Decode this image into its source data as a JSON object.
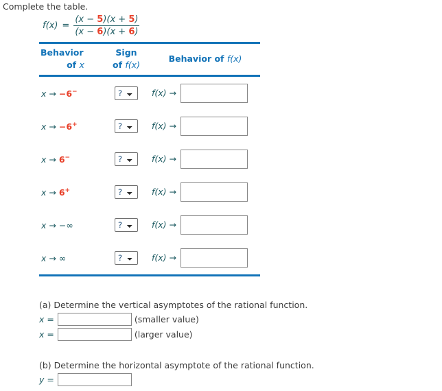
{
  "prompt": "Complete the table.",
  "function": {
    "lhs": "f(x)",
    "equals": "=",
    "numerator": {
      "p1_open": "(x − ",
      "p1_num": "5",
      "p1_close": ")(x + ",
      "p1_num2": "5",
      "p1_end": ")"
    },
    "denominator": {
      "p1_open": "(x − ",
      "p1_num": "6",
      "p1_close": ")(x + ",
      "p1_num2": "6",
      "p1_end": ")"
    }
  },
  "table": {
    "headers": {
      "col1_line1": "Behavior",
      "col1_line2_prefix": "of ",
      "col1_line2_var": "x",
      "col2_line1": "Sign",
      "col2_line2_prefix": "of ",
      "col2_line2_var": "f(x)",
      "col3_prefix": "Behavior of ",
      "col3_var": "f(x)"
    },
    "rows": [
      {
        "approach_var": "x",
        "approach_arrow": "→",
        "approach_sign": "−",
        "approach_value": "6",
        "approach_sup": "−",
        "value_is_red": true,
        "sign_value": "?",
        "behavior_label": "f(x)",
        "behavior_arrow": "→",
        "behavior_value": ""
      },
      {
        "approach_var": "x",
        "approach_arrow": "→",
        "approach_sign": "−",
        "approach_value": "6",
        "approach_sup": "+",
        "value_is_red": true,
        "sign_value": "?",
        "behavior_label": "f(x)",
        "behavior_arrow": "→",
        "behavior_value": ""
      },
      {
        "approach_var": "x",
        "approach_arrow": "→",
        "approach_sign": "",
        "approach_value": "6",
        "approach_sup": "−",
        "value_is_red": true,
        "sign_value": "?",
        "behavior_label": "f(x)",
        "behavior_arrow": "→",
        "behavior_value": ""
      },
      {
        "approach_var": "x",
        "approach_arrow": "→",
        "approach_sign": "",
        "approach_value": "6",
        "approach_sup": "+",
        "value_is_red": true,
        "sign_value": "?",
        "behavior_label": "f(x)",
        "behavior_arrow": "→",
        "behavior_value": ""
      },
      {
        "approach_var": "x",
        "approach_arrow": "→",
        "approach_sign": "−",
        "approach_value": "∞",
        "approach_sup": "",
        "value_is_red": false,
        "sign_value": "?",
        "behavior_label": "f(x)",
        "behavior_arrow": "→",
        "behavior_value": ""
      },
      {
        "approach_var": "x",
        "approach_arrow": "→",
        "approach_sign": "",
        "approach_value": "∞",
        "approach_sup": "",
        "value_is_red": false,
        "sign_value": "?",
        "behavior_label": "f(x)",
        "behavior_arrow": "→",
        "behavior_value": ""
      }
    ],
    "sign_options": [
      "?",
      "+",
      "−"
    ]
  },
  "part_a": {
    "question": "(a) Determine the vertical asymptotes of the rational function.",
    "row1_var": "x =",
    "row1_value": "",
    "row1_hint": "(smaller value)",
    "row2_var": "x =",
    "row2_value": "",
    "row2_hint": "(larger value)"
  },
  "part_b": {
    "question": "(b) Determine the horizontal asymptote of the rational function.",
    "row1_var": "y =",
    "row1_value": ""
  },
  "colors": {
    "rule_blue": "#1273b8",
    "header_blue": "#1273b8",
    "math_teal": "#1f5c63",
    "accent_red": "#e8402a",
    "body_text": "#3b3b3b"
  }
}
